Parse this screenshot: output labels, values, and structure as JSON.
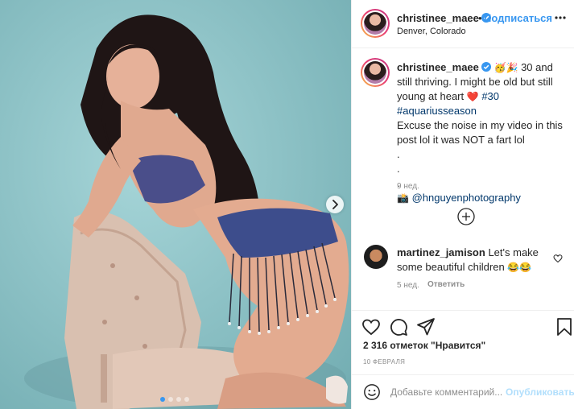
{
  "header": {
    "username": "christinee_maee",
    "follow_separator": "•",
    "follow_label": "Подписаться",
    "location": "Denver, Colorado"
  },
  "caption": {
    "username": "christinee_maee",
    "emoji_1": "🥳",
    "emoji_2": "🎉",
    "text_1": "30 and still thriving. I might be old but still young at heart",
    "heart_emoji": "❤️",
    "hashtag_1": "#30",
    "hashtag_2": "#aquariusseason",
    "text_2": "Excuse the noise in my video in this post lol it was NOT a fart lol",
    "dot_1": ".",
    "dot_2": ".",
    "dot_3": ".",
    "camera_emoji": "📸",
    "mention": "@hnguyenphotography",
    "time": "9 нед."
  },
  "comment": {
    "username": "martinez_jamison",
    "text": "Let's make some beautiful children",
    "emojis": "😂😂",
    "time": "5 нед.",
    "reply_label": "Ответить"
  },
  "actions": {
    "likes": "2 316 отметок \"Нравится\"",
    "date": "10 ФЕВРАЛЯ"
  },
  "add_comment": {
    "placeholder": "Добавьте комментарий...",
    "publish_label": "Опубликовать"
  },
  "carousel": {
    "count": 4,
    "active_index": 0
  },
  "colors": {
    "accent": "#3897f0",
    "background_photo": "#8fc4c8",
    "hashtag": "#00376b",
    "muted": "#8e8e8e"
  },
  "icons": [
    "verified-badge-icon",
    "more-options-icon",
    "load-more-comments-icon",
    "like-heart-icon",
    "comment-icon",
    "share-icon",
    "save-bookmark-icon",
    "emoji-icon",
    "next-arrow-icon"
  ]
}
